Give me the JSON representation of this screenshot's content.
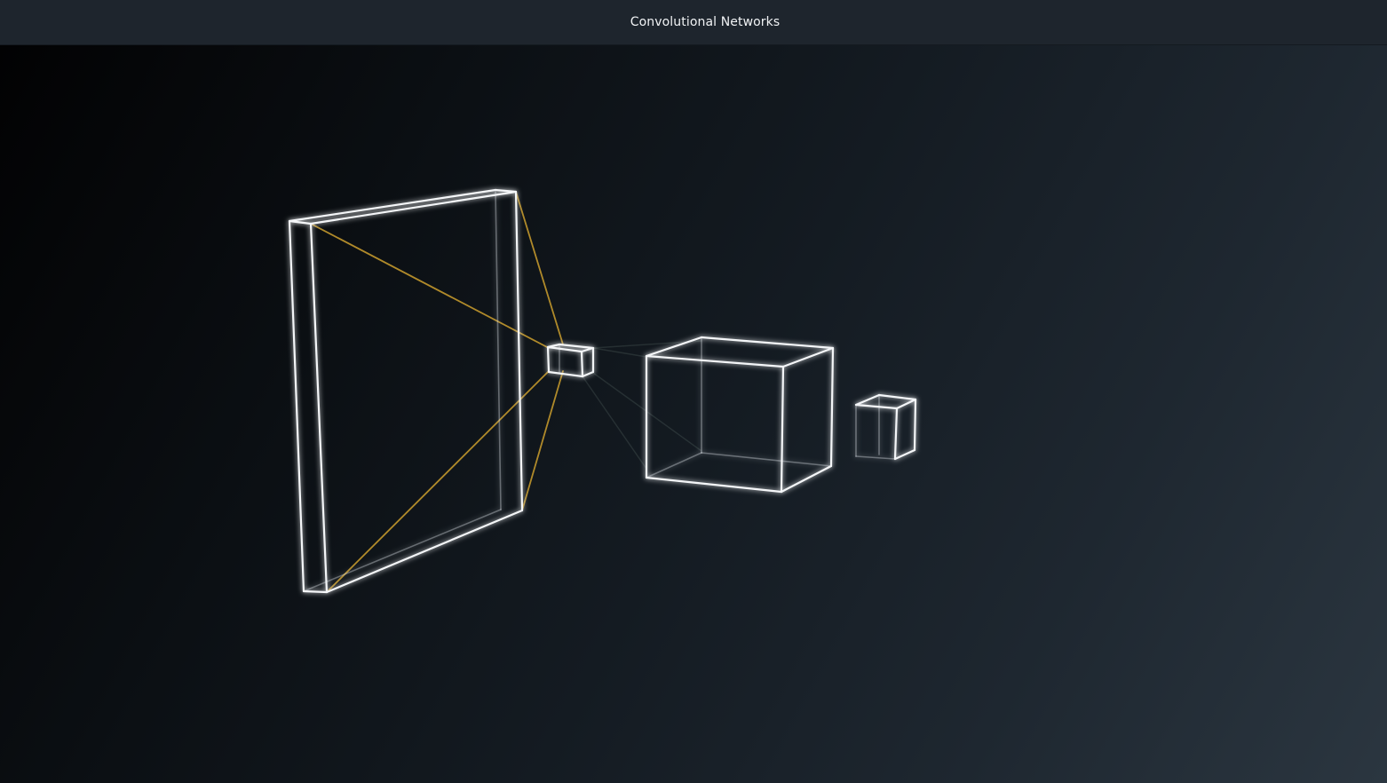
{
  "window": {
    "title": "Convolutional Networks"
  },
  "scene": {
    "description_free": true,
    "colors": {
      "wireframe": "#f4f6f8",
      "receptive_field_rays": "#b08a2a",
      "background_dark": "#020203",
      "background_light": "#2b3640",
      "titlebar": "#1e252d"
    },
    "objects": [
      "input-layer-slab",
      "convolution-filter-cube",
      "feature-map-cube",
      "output-cube"
    ]
  }
}
